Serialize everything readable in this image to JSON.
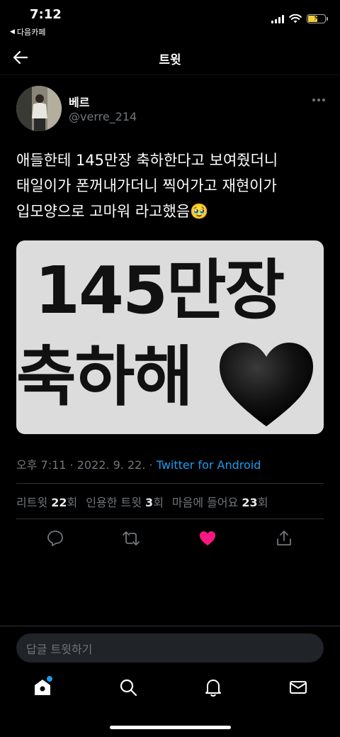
{
  "status": {
    "time": "7:12",
    "back_app": "다음카페"
  },
  "nav": {
    "title": "트윗"
  },
  "tweet": {
    "name": "베르",
    "handle": "@verre_214",
    "text": "애들한테 145만장 축하한다고 보여줬더니\n태일이가 폰꺼내가더니 찍어가고 재현이가\n입모양으로 고마워 라고했음🥹",
    "media": {
      "line1": "145만장",
      "line2": "축하해"
    },
    "meta": {
      "time": "오후 7:11",
      "date": "2022. 9. 22.",
      "source": "Twitter for Android",
      "sep": "·"
    },
    "stats": {
      "retweets_label": "리트윗",
      "retweets": "22",
      "retweets_unit": "회",
      "quotes_label": "인용한 트윗",
      "quotes": "3",
      "quotes_unit": "회",
      "likes_label": "마음에 들어요",
      "likes": "23",
      "likes_unit": "회"
    }
  },
  "reply": {
    "placeholder": "답글 트윗하기"
  },
  "colors": {
    "accent": "#1d9bf0",
    "like": "#f91880",
    "background": "#000000"
  },
  "icons": [
    "back-arrow-icon",
    "more-icon",
    "reply-icon",
    "retweet-icon",
    "like-icon",
    "share-icon",
    "home-icon",
    "search-icon",
    "notifications-icon",
    "messages-icon"
  ]
}
